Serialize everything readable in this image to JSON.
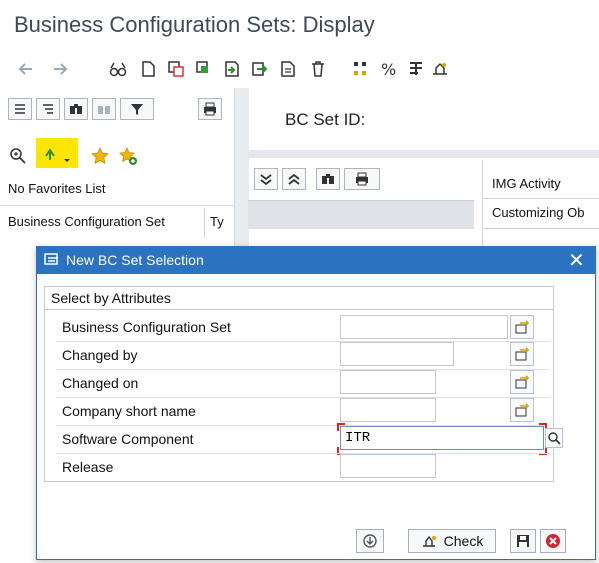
{
  "window": {
    "title": "Business Configuration Sets: Display"
  },
  "left_pane": {
    "favorites_label": "No Favorites List",
    "column_header": "Business Configuration Set",
    "column_header_type": "Ty"
  },
  "right_pane": {
    "bc_set_id_label": "BC Set ID:",
    "img_activity_label": "IMG Activity",
    "customizing_label": "Customizing Ob"
  },
  "dialog": {
    "title": "New BC Set Selection",
    "close_glyph": "✕",
    "group_label": "Select by Attributes",
    "fields": [
      {
        "label": "Business Configuration Set",
        "value": ""
      },
      {
        "label": "Changed by",
        "value": ""
      },
      {
        "label": "Changed on",
        "value": ""
      },
      {
        "label": "Company short name",
        "value": ""
      },
      {
        "label": "Software Component",
        "value": "ITR"
      },
      {
        "label": "Release",
        "value": ""
      }
    ],
    "check_label": "Check"
  },
  "colors": {
    "dialog_title_bg": "#2b73c1",
    "title_text": "#3c4a57",
    "highlight": "#ffe600",
    "cancel_red": "#d9232d"
  }
}
